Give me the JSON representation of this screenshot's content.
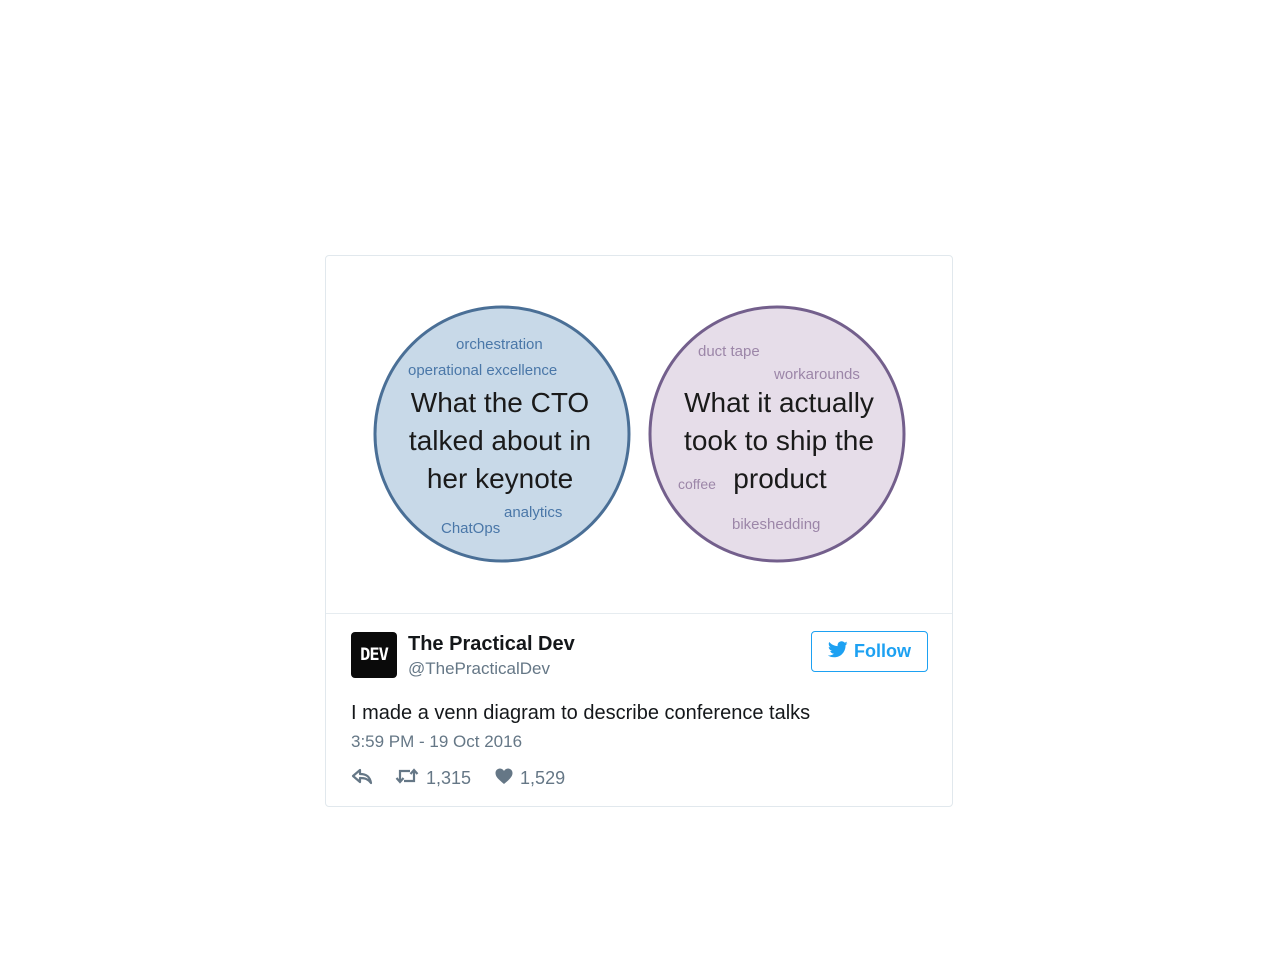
{
  "image": {
    "left_circle": {
      "title": "What the CTO talked about in her keynote",
      "title_lines": [
        "What the CTO",
        "talked about in",
        "her keynote"
      ],
      "words": [
        "orchestration",
        "operational excellence",
        "analytics",
        "ChatOps"
      ],
      "fill": "#c8d9e8",
      "stroke": "#4a6f96"
    },
    "right_circle": {
      "title": "What it actually took to ship the product",
      "title_lines": [
        "What it actually",
        "took to ship the",
        "product"
      ],
      "words": [
        "duct tape",
        "workarounds",
        "coffee",
        "bikeshedding"
      ],
      "fill": "#e6dde9",
      "stroke": "#735f8c"
    }
  },
  "author": {
    "avatar_text": "DEV",
    "name": "The Practical Dev",
    "handle": "@ThePracticalDev"
  },
  "follow_label": "Follow",
  "follow_icon": "twitter-bird-icon",
  "tweet_text": "I made a venn diagram to describe conference talks",
  "timestamp": "3:59 PM - 19 Oct 2016",
  "actions": {
    "reply_icon": "reply-icon",
    "retweet_icon": "retweet-icon",
    "retweets": "1,315",
    "like_icon": "heart-icon",
    "likes": "1,529"
  },
  "colors": {
    "accent": "#1da1f2",
    "secondary_text": "#657786",
    "border": "#e1e8ed"
  }
}
